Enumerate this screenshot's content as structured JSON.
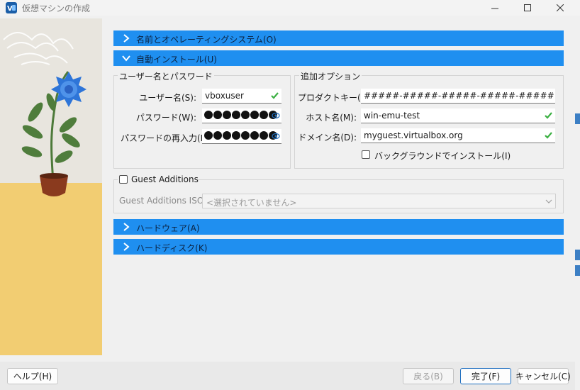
{
  "window": {
    "title": "仮想マシンの作成",
    "app_icon": "virtualbox-logo-icon"
  },
  "sections": {
    "name_os": {
      "label": "名前とオペレーティングシステム(O)",
      "expanded": false
    },
    "unattended": {
      "label": "自動インストール(U)",
      "expanded": true
    },
    "hardware": {
      "label": "ハードウェア(A)",
      "expanded": false
    },
    "harddisk": {
      "label": "ハードディスク(K)",
      "expanded": false
    }
  },
  "credentials": {
    "group_title": "ユーザー名とパスワード",
    "username_label": "ユーザー名(S):",
    "username_value": "vboxuser",
    "password_label": "パスワード(W):",
    "password_repeat_label": "パスワードの再入力(R):"
  },
  "additional": {
    "group_title": "追加オプション",
    "product_key_label": "プロダクトキー(P):",
    "product_key_value": "#####-#####-#####-#####-#####",
    "hostname_label": "ホスト名(M):",
    "hostname_value": "win-emu-test",
    "domain_label": "ドメイン名(D):",
    "domain_value": "myguest.virtualbox.org",
    "background_install_label": "バックグラウンドでインストール(I)",
    "background_install_checked": false
  },
  "guest_additions": {
    "checkbox_label": "Guest Additions",
    "checked": false,
    "iso_label": "Guest Additions ISO:",
    "iso_value": "<選択されていません>"
  },
  "buttons": {
    "help": "ヘルプ(H)",
    "back": "戻る(B)",
    "finish": "完了(F)",
    "cancel": "キャンセル(C)"
  },
  "colors": {
    "accent": "#1f8ff0",
    "valid": "#3cb043"
  }
}
